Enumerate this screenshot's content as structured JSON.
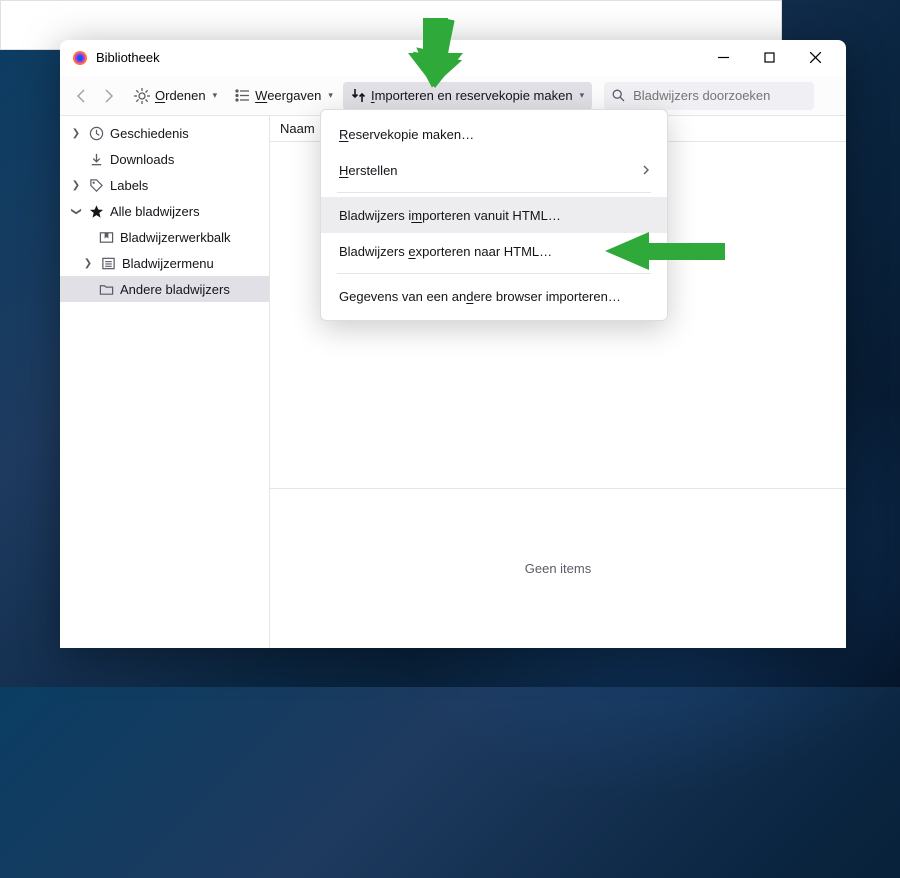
{
  "window": {
    "title": "Bibliotheek"
  },
  "toolbar": {
    "organize": "Ordenen",
    "views": "Weergaven",
    "import": "Importeren en reservekopie maken"
  },
  "search": {
    "placeholder": "Bladwijzers doorzoeken"
  },
  "sidebar": {
    "history": "Geschiedenis",
    "downloads": "Downloads",
    "labels": "Labels",
    "all_bookmarks": "Alle bladwijzers",
    "toolbar": "Bladwijzerwerkbalk",
    "menu": "Bladwijzermenu",
    "other": "Andere bladwijzers"
  },
  "columns": {
    "name": "Naam"
  },
  "detail": {
    "empty": "Geen items"
  },
  "menu": {
    "backup": "Reservekopie maken…",
    "restore": "Herstellen",
    "import_html": "Bladwijzers importeren vanuit HTML…",
    "export_html": "Bladwijzers exporteren naar HTML…",
    "import_browser": "Gegevens van een andere browser importeren…"
  },
  "underlines": {
    "organize": "O",
    "views": "W",
    "import_btn": "I",
    "backup": "R",
    "restore": "H",
    "import_html": "m",
    "export_html": "e",
    "import_browser": "d"
  }
}
